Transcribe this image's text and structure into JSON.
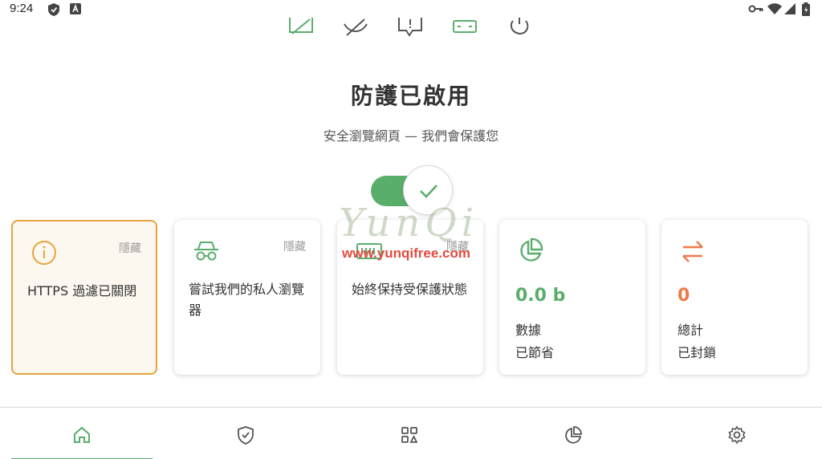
{
  "status_bar": {
    "time": "9:24",
    "left_icons": [
      "shield-status-icon",
      "letter-a-icon"
    ],
    "right_icons": [
      "vpn-key-icon",
      "wifi-icon",
      "cell-signal-icon",
      "battery-icon"
    ]
  },
  "top_tools": [
    "ad-block-icon",
    "tracker-block-icon",
    "message-alert-icon",
    "card-icon",
    "refresh-icon"
  ],
  "header": {
    "title": "防護已啟用",
    "subtitle": "安全瀏覽網頁 — 我們會保護您"
  },
  "protection_toggle": {
    "on": true,
    "color": "#5aae6c"
  },
  "cards": {
    "https": {
      "hide": "隱藏",
      "text": "HTTPS 過濾已關閉",
      "accent": "#e8a33d"
    },
    "browser": {
      "hide": "隱藏",
      "text": "嘗試我們的私人瀏覽器"
    },
    "always": {
      "hide": "隱藏",
      "text": "始終保持受保護狀態"
    },
    "data": {
      "value": "0.0 b",
      "label_line1": "數據",
      "label_line2": "已節省",
      "accent": "#5aae6c"
    },
    "blocked": {
      "value": "0",
      "label_line1": "總計",
      "label_line2": "已封鎖",
      "accent": "#ee7a4a"
    }
  },
  "watermark": {
    "text": "YunQi",
    "url": "www.yunqifree.com"
  },
  "bottom_nav": [
    {
      "icon": "home-icon",
      "active": true
    },
    {
      "icon": "shield-check-icon",
      "active": false
    },
    {
      "icon": "apps-grid-icon",
      "active": false
    },
    {
      "icon": "stats-pie-icon",
      "active": false
    },
    {
      "icon": "settings-gear-icon",
      "active": false
    }
  ]
}
